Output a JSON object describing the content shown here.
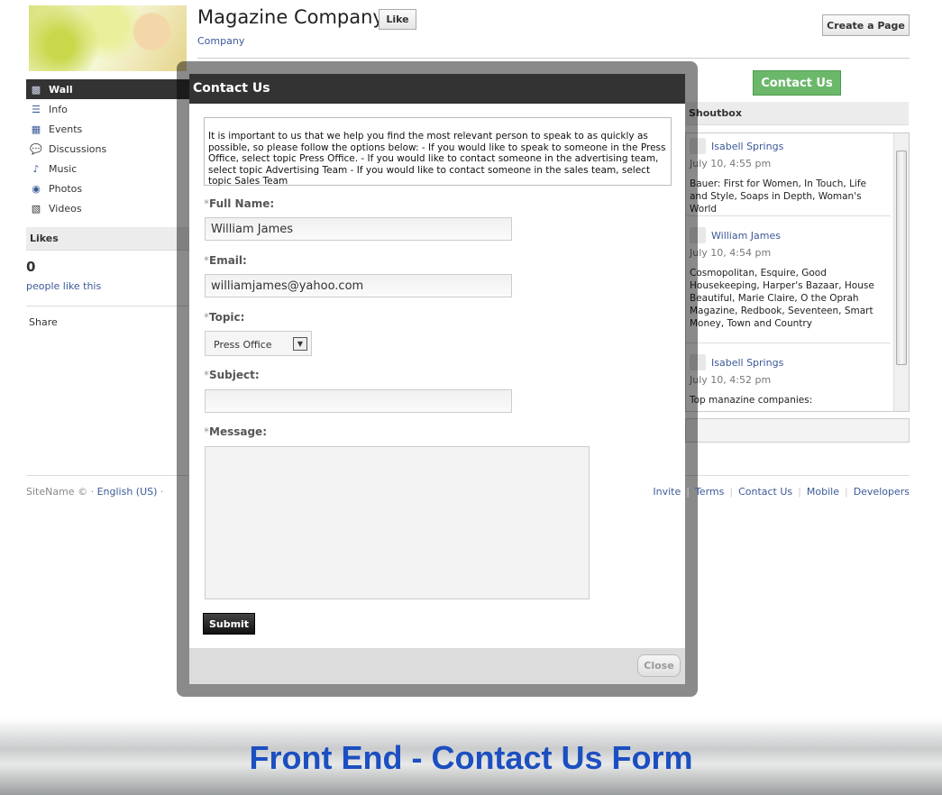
{
  "page": {
    "title": "Magazine Company",
    "category": "Company",
    "like_label": "Like",
    "create_page_label": "Create a Page",
    "contact_button": "Contact Us"
  },
  "sidebar": {
    "items": [
      {
        "label": "Wall",
        "icon": "speech-bubble-icon"
      },
      {
        "label": "Info",
        "icon": "info-list-icon"
      },
      {
        "label": "Events",
        "icon": "calendar-icon"
      },
      {
        "label": "Discussions",
        "icon": "discussion-icon"
      },
      {
        "label": "Music",
        "icon": "music-note-icon"
      },
      {
        "label": "Photos",
        "icon": "camera-icon"
      },
      {
        "label": "Videos",
        "icon": "film-icon"
      }
    ],
    "likes_header": "Likes",
    "likes_count": "0",
    "likes_text": "people like this",
    "share": "Share"
  },
  "shoutbox": {
    "header": "Shoutbox",
    "posts": [
      {
        "name": "Isabell Springs",
        "time": "July 10, 4:55 pm",
        "message": "Bauer: First for Women, In Touch, Life and Style, Soaps in Depth, Woman's World"
      },
      {
        "name": "William James",
        "time": "July 10, 4:54 pm",
        "message": "Cosmopolitan, Esquire, Good Housekeeping, Harper's Bazaar, House Beautiful, Marie Claire, O the Oprah Magazine, Redbook, Seventeen, Smart Money, Town and Country"
      },
      {
        "name": "Isabell Springs",
        "time": "July 10, 4:52 pm",
        "message": "Top manazine companies:"
      }
    ]
  },
  "footer": {
    "site": "SiteName ©",
    "language": "English (US)",
    "links": [
      "Invite",
      "Terms",
      "Contact Us",
      "Mobile",
      "Developers"
    ]
  },
  "modal": {
    "title": "Contact Us",
    "intro": "It is important to us that we help you find the most relevant person to speak to as quickly as possible, so please follow the options below: - If you would like to speak to someone in the Press Office, select topic Press Office. - If you would like to contact someone in the advertising team, select topic Advertising Team - If you would like to contact someone in the sales team, select topic Sales Team",
    "required_mark": "*",
    "full_name_label": "Full Name:",
    "full_name_value": "William James",
    "email_label": "Email:",
    "email_value": "williamjames@yahoo.com",
    "topic_label": "Topic:",
    "topic_value": "Press Office",
    "subject_label": "Subject:",
    "subject_value": "",
    "message_label": "Message:",
    "message_value": "",
    "submit_label": "Submit",
    "close_label": "Close"
  },
  "banner": {
    "text": "Front End - Contact Us Form",
    "color": "#1c4fc0"
  }
}
